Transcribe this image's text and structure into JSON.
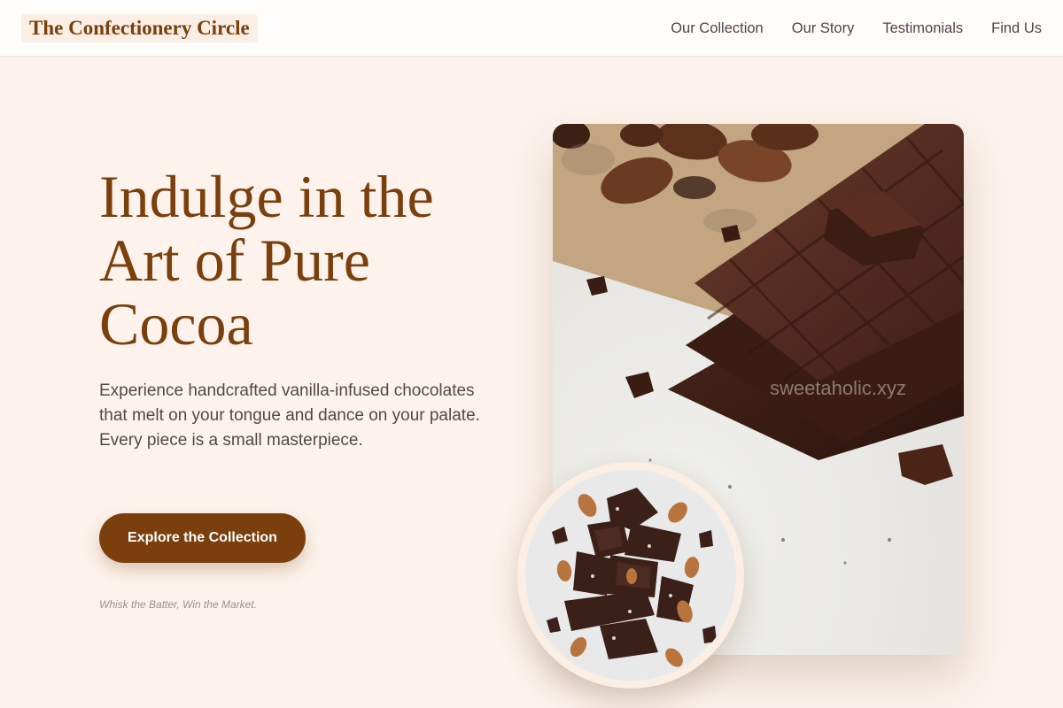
{
  "header": {
    "logo": "The Confectionery Circle",
    "nav": [
      "Our Collection",
      "Our Story",
      "Testimonials",
      "Find Us"
    ]
  },
  "hero": {
    "title": "Indulge in the Art of Pure Cocoa",
    "description": "Experience handcrafted vanilla-infused chocolates that melt on your tongue and dance on your palate. Every piece is a small masterpiece.",
    "cta_label": "Explore the Collection",
    "tagline": "Whisk the Batter, Win the Market."
  },
  "images": {
    "main_watermark": "sweetaholic.xyz",
    "main_icon": "chocolate-bars-photo",
    "inset_icon": "chocolate-almond-pieces-photo"
  },
  "colors": {
    "accent": "#7a3f0c",
    "background": "#fdf3ec",
    "header_bg": "#fffdfb"
  }
}
